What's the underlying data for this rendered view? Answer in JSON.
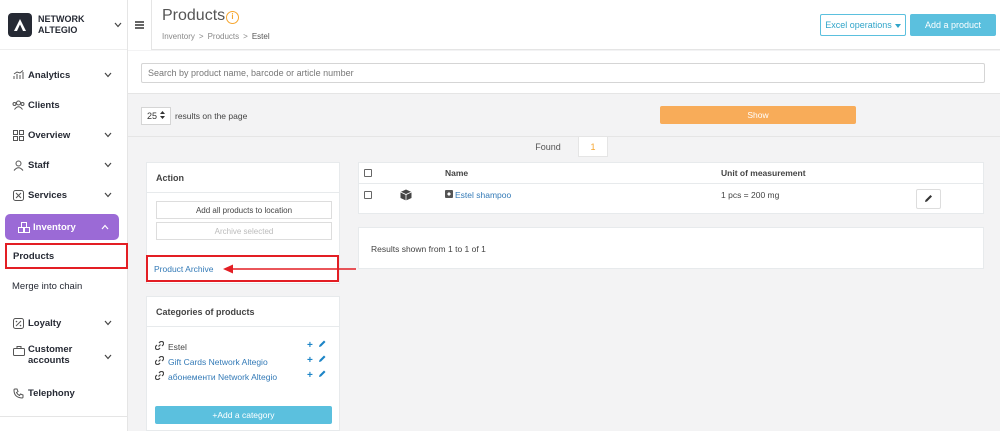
{
  "brand": {
    "name": "NETWORK ALTEGIO"
  },
  "sidebar": {
    "items": [
      {
        "label": "Analytics",
        "icon": "analytics-icon"
      },
      {
        "label": "Clients",
        "icon": "clients-icon"
      },
      {
        "label": "Overview",
        "icon": "overview-icon"
      },
      {
        "label": "Staff",
        "icon": "staff-icon"
      },
      {
        "label": "Services",
        "icon": "services-icon"
      },
      {
        "label": "Inventory",
        "icon": "inventory-icon"
      },
      {
        "label": "Products"
      },
      {
        "label": "Merge into chain"
      },
      {
        "label": "Loyalty",
        "icon": "loyalty-icon"
      },
      {
        "label": "Customer accounts",
        "icon": "customer-accounts-icon"
      },
      {
        "label": "Telephony",
        "icon": "phone-icon"
      }
    ]
  },
  "header": {
    "title": "Products",
    "info_badge": "i",
    "breadcrumb": [
      "Inventory",
      "Products",
      "Estel"
    ],
    "excel_button": "Excel operations",
    "add_product_button": "Add a product"
  },
  "search": {
    "placeholder": "Search by product name, barcode or article number"
  },
  "pagination": {
    "per_page": "25",
    "per_page_label": "results on the page",
    "show_button": "Show"
  },
  "found": {
    "label": "Found",
    "count": "1"
  },
  "action_panel": {
    "title": "Action",
    "add_all_button": "Add all products to location",
    "archive_selected_button": "Archive selected",
    "archive_link": "Product Archive"
  },
  "categories_panel": {
    "title": "Categories of products",
    "items": [
      {
        "name": "Estel"
      },
      {
        "name": "Gift Cards Network Altegio"
      },
      {
        "name": "абонементи Network Altegio"
      }
    ],
    "add_button": "+Add a category"
  },
  "products_table": {
    "headers": {
      "name": "Name",
      "unit": "Unit of measurement"
    },
    "rows": [
      {
        "name": "Estel shampoo",
        "unit": "1 pcs = 200 mg"
      }
    ],
    "summary": "Results shown from 1 to 1 of 1"
  },
  "colors": {
    "accent": "#9b6ad6",
    "info": "#5bc0de",
    "show": "#f8ac59",
    "highlight": "#e31e24"
  }
}
